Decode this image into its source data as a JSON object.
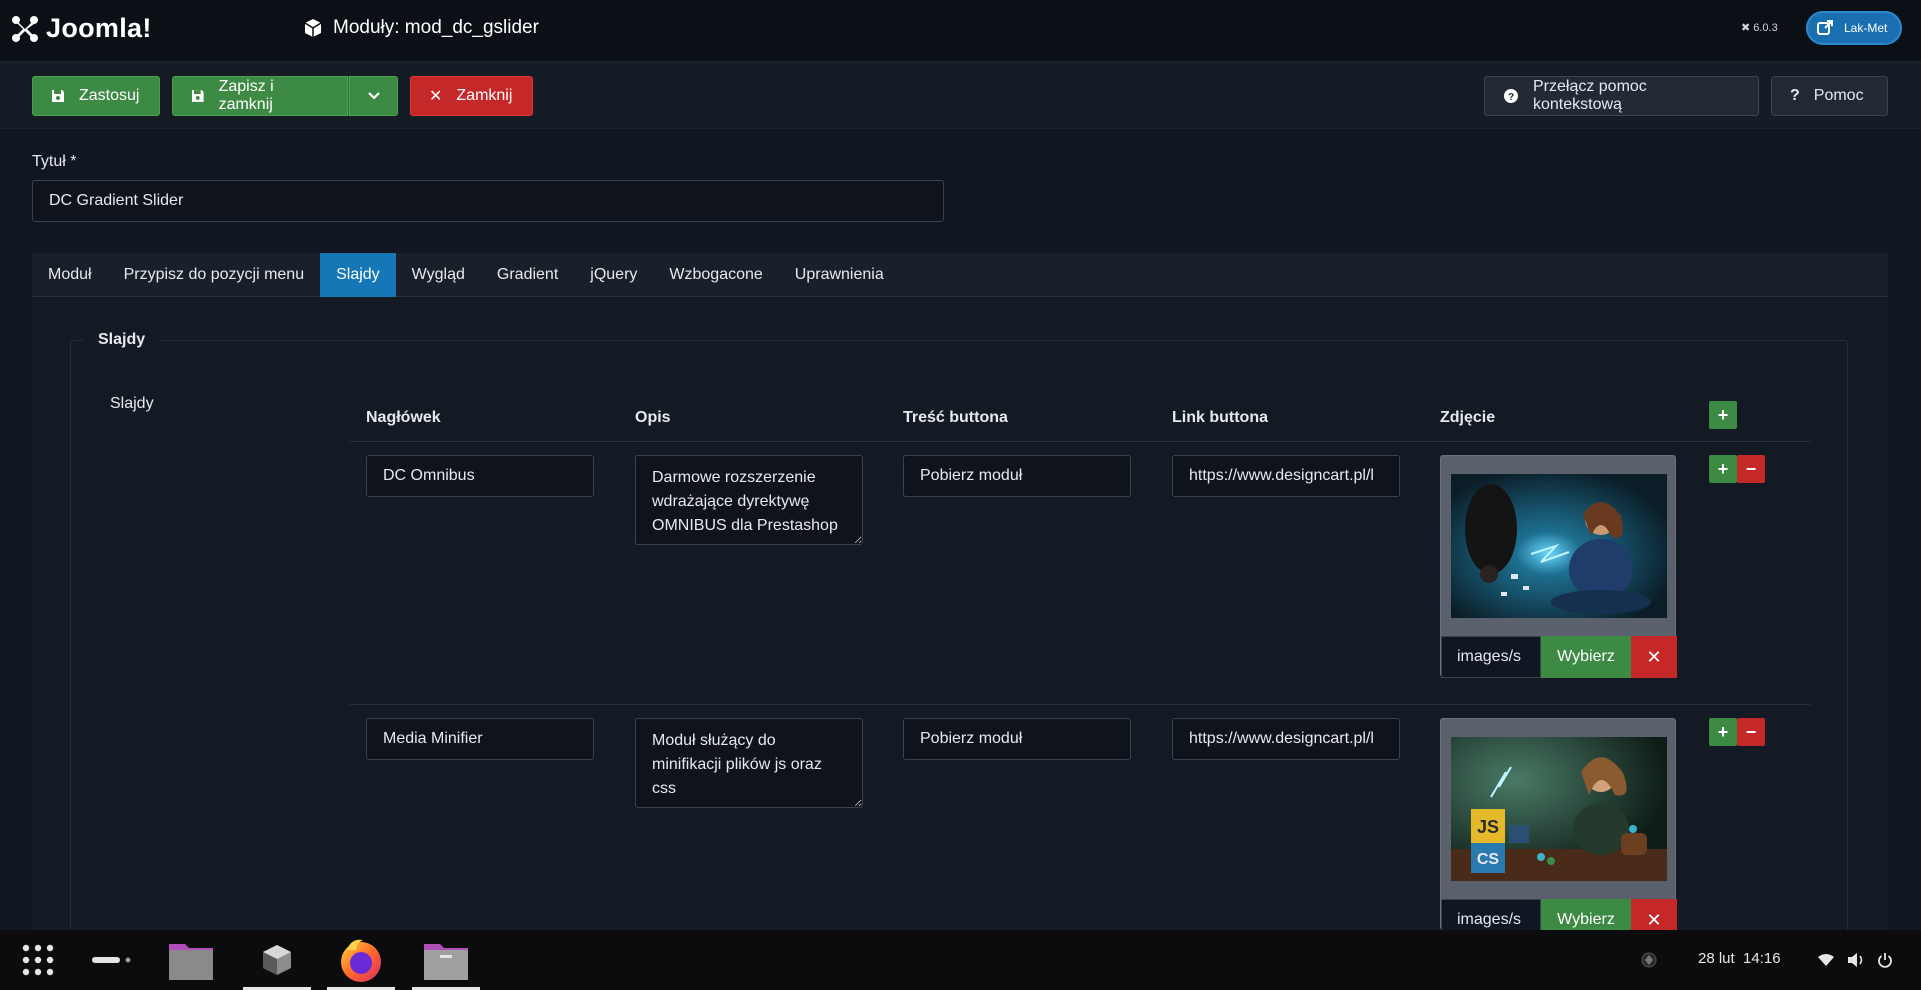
{
  "header": {
    "logo_text": "Joomla!",
    "page_title": "Moduły: mod_dc_gslider",
    "version": "6.0.3",
    "user": "Lak-Met"
  },
  "toolbar": {
    "apply": "Zastosuj",
    "save_close": "Zapisz i zamknij",
    "close": "Zamknij",
    "toggle_help": "Przełącz pomoc kontekstową",
    "help": "Pomoc"
  },
  "form": {
    "title_label": "Tytuł *",
    "title_value": "DC Gradient Slider"
  },
  "tabs": [
    {
      "label": "Moduł",
      "active": false
    },
    {
      "label": "Przypisz do pozycji menu",
      "active": false
    },
    {
      "label": "Slajdy",
      "active": true
    },
    {
      "label": "Wygląd",
      "active": false
    },
    {
      "label": "Gradient",
      "active": false
    },
    {
      "label": "jQuery",
      "active": false
    },
    {
      "label": "Wzbogacone",
      "active": false
    },
    {
      "label": "Uprawnienia",
      "active": false
    }
  ],
  "slides": {
    "legend": "Slajdy",
    "field_label": "Slajdy",
    "columns": [
      "Nagłówek",
      "Opis",
      "Treść buttona",
      "Link buttona",
      "Zdjęcie"
    ],
    "add_symbol": "+",
    "remove_symbol": "−",
    "clear_symbol": "✕",
    "choose_label": "Wybierz",
    "rows": [
      {
        "heading": "DC Omnibus",
        "description": "Darmowe rozszerzenie wdrażające dyrektywę OMNIBUS dla Prestashop",
        "button_text": "Pobierz moduł",
        "button_link": "https://www.designcart.pl/l",
        "image_path": "images/s"
      },
      {
        "heading": "Media Minifier",
        "description": "Moduł służący do minifikacji plików js oraz css",
        "button_text": "Pobierz moduł",
        "button_link": "https://www.designcart.pl/l",
        "image_path": "images/s"
      }
    ]
  },
  "taskbar": {
    "date": "28 lut",
    "time": "14:16"
  },
  "colors": {
    "accent": "#1577b6",
    "success": "#3d8a45",
    "danger": "#c52828"
  }
}
